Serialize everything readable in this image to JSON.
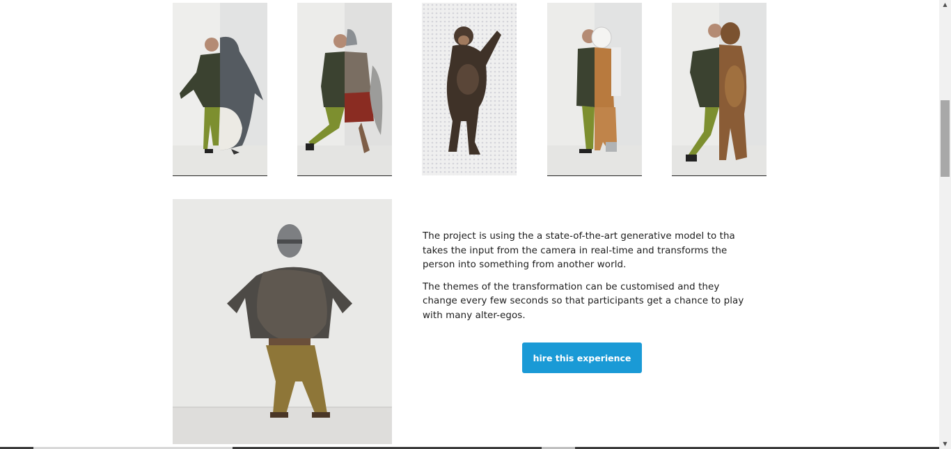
{
  "thumbnails": [
    {
      "name": "penguin-transformation",
      "subject": "penguin"
    },
    {
      "name": "gladiator-transformation",
      "subject": "gladiator"
    },
    {
      "name": "chimpanzee-transformation",
      "subject": "chimpanzee"
    },
    {
      "name": "astronaut-transformation",
      "subject": "astronaut"
    },
    {
      "name": "bear-transformation",
      "subject": "bear"
    }
  ],
  "hero_image": {
    "subject": "armored-knight"
  },
  "description": {
    "paragraph_1": "The project is using the a state-of-the-art generative model to tha takes the input from the camera in real-time and transforms the person into something from another world.",
    "paragraph_2": "The themes of the transformation can be customised and they change every few seconds so that participants get a chance to play with many alter-egos."
  },
  "cta": {
    "label": "hire this experience"
  },
  "colors": {
    "accent": "#1a9ad6",
    "text": "#1b1b1b",
    "background": "#ffffff"
  }
}
